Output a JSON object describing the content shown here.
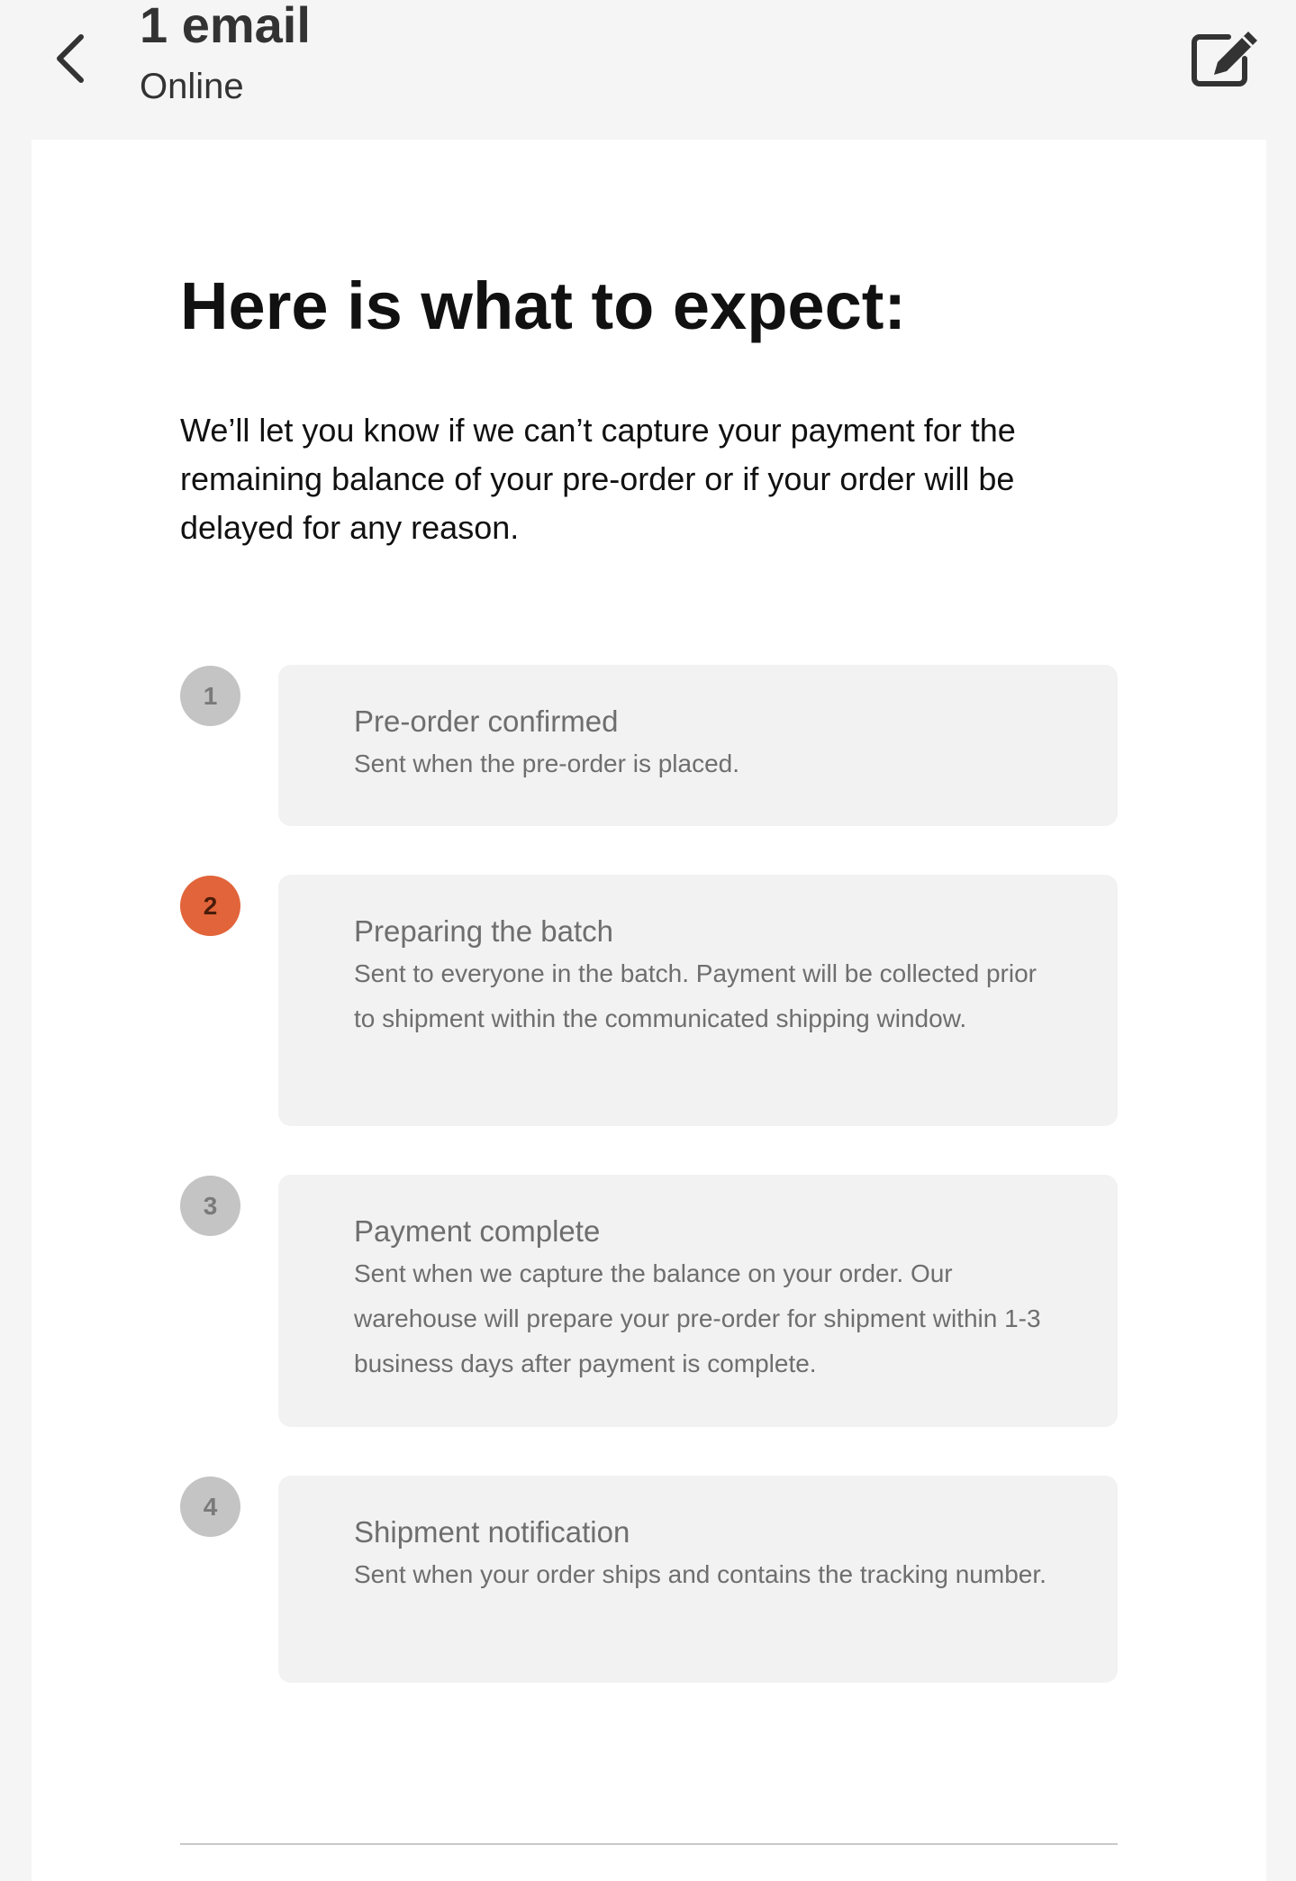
{
  "header": {
    "title": "1 email",
    "subtitle": "Online",
    "back_icon": "chevron-left-icon",
    "compose_icon": "compose-icon"
  },
  "email": {
    "heading": "Here is what to expect:",
    "intro": "We’ll let you know if we can’t capture your payment for the remaining balance of your pre-order or if your order will be delayed for any reason.",
    "steps": [
      {
        "number": "1",
        "title": "Pre-order confirmed",
        "description": "Sent when the pre-order is placed.",
        "active": false
      },
      {
        "number": "2",
        "title": "Preparing the batch",
        "description": "Sent to everyone in the batch. Payment will be collected prior to shipment within the communicated shipping window.",
        "active": true
      },
      {
        "number": "3",
        "title": "Payment complete",
        "description": "Sent when we capture the balance on your order. Our warehouse will prepare your pre-order for shipment within 1-3 business days after payment is complete.",
        "active": false
      },
      {
        "number": "4",
        "title": "Shipment notification",
        "description": "Sent when your order ships and contains the tracking number.",
        "active": false
      }
    ]
  },
  "colors": {
    "active_step": "#e2643a",
    "inactive_step": "#c4c4c4",
    "step_box": "#f2f2f2"
  }
}
